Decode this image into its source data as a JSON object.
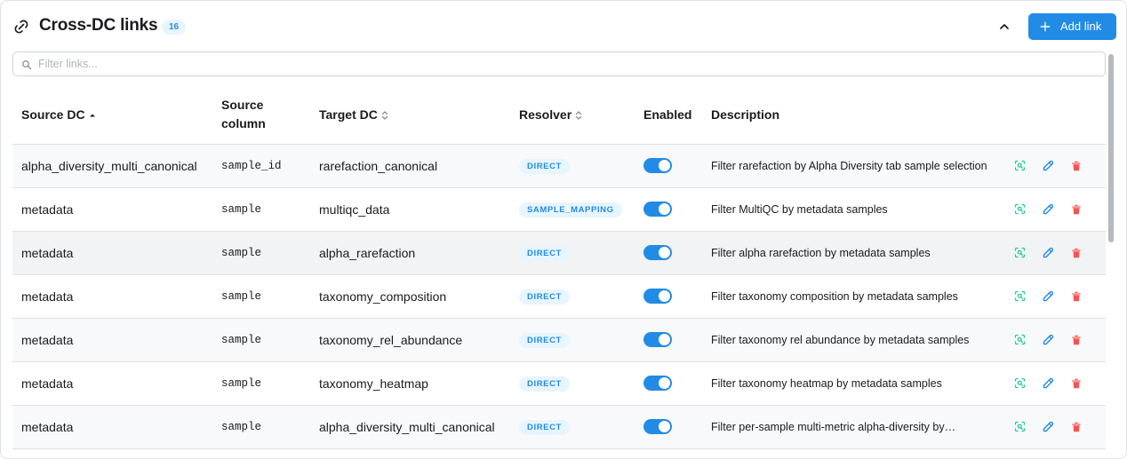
{
  "header": {
    "title": "Cross-DC links",
    "count": "16",
    "add_label": "Add link"
  },
  "search": {
    "placeholder": "Filter links..."
  },
  "table": {
    "columns": [
      "Source DC",
      "Source column",
      "Target DC",
      "Resolver",
      "Enabled",
      "Description"
    ],
    "sorted_column": "Source DC",
    "rows": [
      {
        "source_dc": "alpha_diversity_multi_canonical",
        "source_column": "sample_id",
        "target_dc": "rarefaction_canonical",
        "resolver": "DIRECT",
        "enabled": true,
        "description": "Filter rarefaction by Alpha Diversity tab sample selection"
      },
      {
        "source_dc": "metadata",
        "source_column": "sample",
        "target_dc": "multiqc_data",
        "resolver": "SAMPLE_MAPPING",
        "enabled": true,
        "description": "Filter MultiQC by metadata samples"
      },
      {
        "source_dc": "metadata",
        "source_column": "sample",
        "target_dc": "alpha_rarefaction",
        "resolver": "DIRECT",
        "enabled": true,
        "description": "Filter alpha rarefaction by metadata samples"
      },
      {
        "source_dc": "metadata",
        "source_column": "sample",
        "target_dc": "taxonomy_composition",
        "resolver": "DIRECT",
        "enabled": true,
        "description": "Filter taxonomy composition by metadata samples"
      },
      {
        "source_dc": "metadata",
        "source_column": "sample",
        "target_dc": "taxonomy_rel_abundance",
        "resolver": "DIRECT",
        "enabled": true,
        "description": "Filter taxonomy rel abundance by metadata samples"
      },
      {
        "source_dc": "metadata",
        "source_column": "sample",
        "target_dc": "taxonomy_heatmap",
        "resolver": "DIRECT",
        "enabled": true,
        "description": "Filter taxonomy heatmap by metadata samples"
      },
      {
        "source_dc": "metadata",
        "source_column": "sample",
        "target_dc": "alpha_diversity_multi_canonical",
        "resolver": "DIRECT",
        "enabled": true,
        "description": "Filter per-sample multi-metric alpha-diversity by…"
      }
    ]
  },
  "colors": {
    "accent": "#228be6",
    "preview_icon": "#20c997",
    "delete_icon": "#fa5252"
  },
  "icons": {
    "title": "link-icon",
    "collapse": "chevron-up-icon",
    "add": "plus-icon",
    "search": "search-icon",
    "preview": "focus-scan-icon",
    "edit": "pencil-icon",
    "delete": "trash-icon"
  }
}
